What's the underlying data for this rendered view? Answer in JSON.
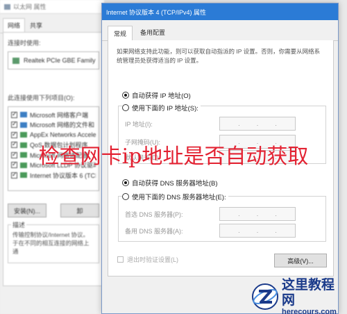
{
  "background_window": {
    "title": "以太网 属性",
    "tabs": [
      "网络",
      "共享"
    ],
    "connect_using_label": "连接时使用:",
    "adapter_name": "Realtek PCIe GBE Family",
    "components_label": "此连接使用下列项目(O):",
    "components": [
      "Microsoft 网络客户端",
      "Microsoft 网络的文件和",
      "AppEx Networks Accele",
      "QoS 数据包计划程序",
      "Microsoft 网络适配器",
      "Microsoft LLDP 协议驱动",
      "Internet 协议版本 6 (TCP"
    ],
    "install_button": "安装(N)...",
    "second_button": "卸",
    "description_legend": "描述",
    "description_text": "传输控制协议/Internet 协议。于在不同的相互连接的网络上通"
  },
  "dialog": {
    "title": "Internet 协议版本 4 (TCP/IPv4) 属性",
    "tabs": [
      "常规",
      "备用配置"
    ],
    "intro_text": "如果网络支持此功能，则可以获取自动指派的 IP 设置。否则，你需要从网络系统管理员处获得适当的 IP 设置。",
    "auto_ip_label": "自动获得 IP 地址(O)",
    "manual_ip_label": "使用下面的 IP 地址(S):",
    "ip_address_label": "IP 地址(I):",
    "subnet_label": "子网掩码(U):",
    "gateway_label": "默认网关(D):",
    "auto_dns_label": "自动获得 DNS 服务器地址(B)",
    "manual_dns_label": "使用下面的 DNS 服务器地址(E):",
    "preferred_dns_label": "首选 DNS 服务器(P):",
    "alternate_dns_label": "备用 DNS 服务器(A):",
    "validate_on_exit_label": "退出时验证设置(L)",
    "advanced_button": "高级(V)...",
    "ip_dot": "."
  },
  "caption": "检查网卡ip地址是否自动获取",
  "watermark": {
    "brand": "这里教程网",
    "url": "herecours.com"
  },
  "colors": {
    "caption": "#e32232",
    "watermark": "#1a3a8a",
    "title_bar": "#2b7bd6"
  }
}
